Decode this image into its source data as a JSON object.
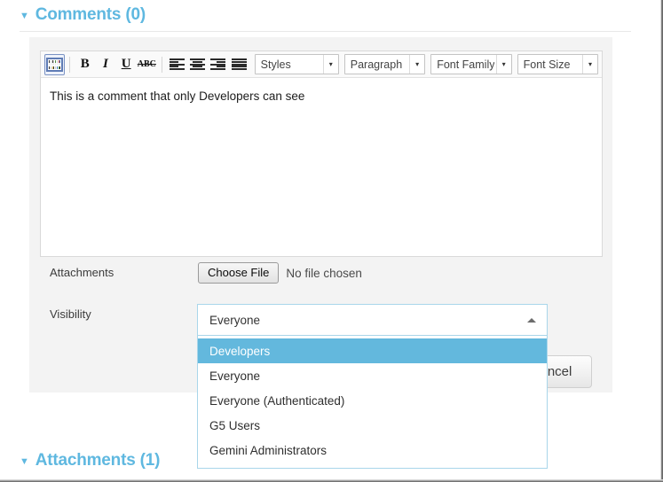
{
  "sections": {
    "comments": {
      "caret": "▼",
      "title": "Comments (0)"
    },
    "attachments": {
      "caret": "▼",
      "title": "Attachments (1)"
    }
  },
  "editor": {
    "toolbar": {
      "source_icon": "template-icon",
      "bold_label": "B",
      "italic_label": "I",
      "underline_label": "U",
      "strikethrough_label": "ABC",
      "align_left": "align-left-icon",
      "align_center": "align-center-icon",
      "align_right": "align-right-icon",
      "align_justify": "align-justify-icon",
      "selects": [
        {
          "name": "styles",
          "label": "Styles",
          "arrow": "▾"
        },
        {
          "name": "paragraph",
          "label": "Paragraph",
          "arrow": "▾"
        },
        {
          "name": "font-family",
          "label": "Font Family",
          "arrow": "▾"
        },
        {
          "name": "font-size",
          "label": "Font Size",
          "arrow": "▾"
        }
      ]
    },
    "content": "This is a comment that only Developers can see"
  },
  "form": {
    "attachments_label": "Attachments",
    "choose_file_label": "Choose File",
    "file_status": "No file chosen",
    "visibility_label": "Visibility",
    "cancel_label": "Cancel"
  },
  "visibility_combo": {
    "value": "Everyone",
    "caret": "▲",
    "options": [
      {
        "label": "Developers",
        "selected": true
      },
      {
        "label": "Everyone",
        "selected": false
      },
      {
        "label": "Everyone (Authenticated)",
        "selected": false
      },
      {
        "label": "G5 Users",
        "selected": false
      },
      {
        "label": "Gemini Administrators",
        "selected": false
      }
    ]
  },
  "colors": {
    "accent": "#5fb8e0",
    "highlight": "#63b8dd",
    "panel": "#f3f3f3",
    "combo_border": "#a9d6ea"
  }
}
